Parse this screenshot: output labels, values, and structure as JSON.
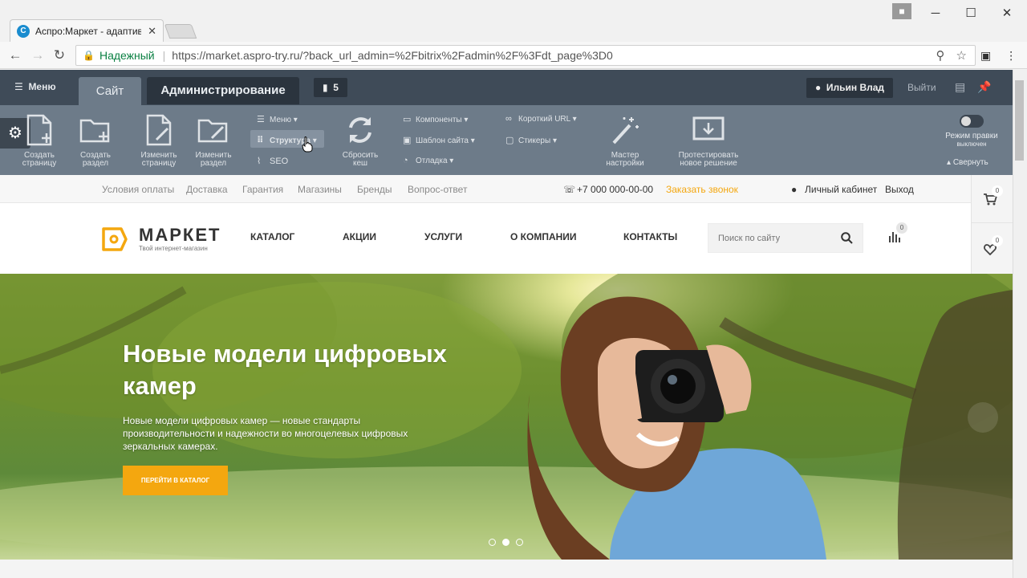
{
  "browser": {
    "tab_title": "Аспро:Маркет - адаптив",
    "tab_favicon_letter": "C",
    "secure_label": "Надежный",
    "url": "https://market.aspro-try.ru/?back_url_admin=%2Fbitrix%2Fadmin%2F%3Fdt_page%3D0",
    "window_controls": [
      "─",
      "☐",
      "✕"
    ]
  },
  "admin": {
    "menu_label": "Меню",
    "site_tab": "Сайт",
    "admin_tab": "Администрирование",
    "notifications_count": "5",
    "user_name": "Ильин Влад",
    "logout_label": "Выйти",
    "tools": [
      {
        "line1": "Создать",
        "line2": "страницу"
      },
      {
        "line1": "Создать",
        "line2": "раздел"
      },
      {
        "line1": "Изменить",
        "line2": "страницу"
      },
      {
        "line1": "Изменить",
        "line2": "раздел"
      },
      {
        "line1": "Сбросить",
        "line2": "кеш"
      },
      {
        "line1": "Мастер",
        "line2": "настройки"
      },
      {
        "line1": "Протестировать",
        "line2": "новое решение"
      }
    ],
    "menu_group1": [
      "Меню",
      "Структура",
      "SEO"
    ],
    "menu_group2": [
      "Компоненты",
      "Шаблон сайта",
      "Отладка"
    ],
    "menu_group3": [
      "Короткий URL",
      "Стикеры"
    ],
    "edit_mode_line1": "Режим правки",
    "edit_mode_line2": "выключен",
    "collapse_label": "Свернуть"
  },
  "site": {
    "top_links": [
      "Условия оплаты",
      "Доставка",
      "Гарантия",
      "Магазины",
      "Бренды",
      "Вопрос-ответ"
    ],
    "phone": "+7 000 000-00-00",
    "callback": "Заказать звонок",
    "account": "Личный кабинет",
    "exit": "Выход",
    "logo_name": "МАРКЕТ",
    "logo_sub": "Твой интернет-магазин",
    "nav": [
      "КАТАЛОГ",
      "АКЦИИ",
      "УСЛУГИ",
      "О КОМПАНИИ",
      "КОНТАКТЫ"
    ],
    "search_placeholder": "Поиск по сайту",
    "compare_count": "0",
    "cart_count": "0",
    "favorites_count": "0"
  },
  "hero": {
    "title": "Новые модели цифровых камер",
    "text": "Новые модели цифровых камер — новые стандарты производительности и надежности во многоцелевых цифровых зеркальных камерах.",
    "button": "ПЕРЕЙТИ В КАТАЛОГ",
    "slides_total": 3,
    "active_slide": 2
  },
  "colors": {
    "admin_dark": "#3f4b58",
    "admin_toolbar": "#6d7b89",
    "accent_orange": "#f4a70f",
    "secure_green": "#0b8043"
  }
}
